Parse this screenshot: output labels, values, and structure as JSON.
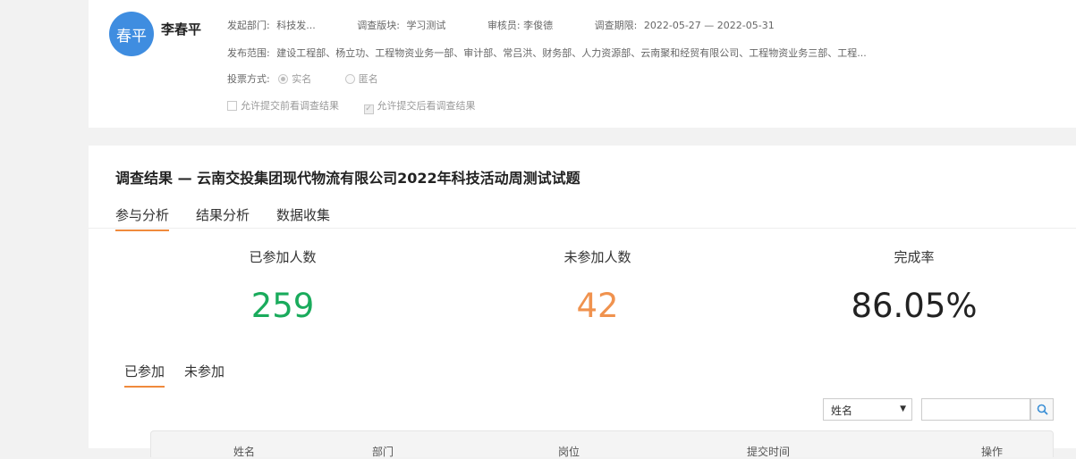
{
  "user": {
    "avatar_text": "春平",
    "name": "李春平"
  },
  "meta": {
    "dept_label": "发起部门:",
    "dept_value": "科技发...",
    "module_label": "调查版块:",
    "module_value": "学习测试",
    "reviewer_label": "审核员:",
    "reviewer_value": "李俊德",
    "period_label": "调查期限:",
    "period_value": "2022-05-27 — 2022-05-31",
    "scope_label": "发布范围:",
    "scope_value": "建设工程部、杨立功、工程物资业务一部、审计部、常吕洪、财务部、人力资源部、云南聚和经贸有限公司、工程物资业务三部、工程...",
    "vote_label": "投票方式:",
    "vote_options": [
      "实名",
      "匿名"
    ],
    "check_before": "允许提交前看调查结果",
    "check_after": "允许提交后看调查结果"
  },
  "page": {
    "title": "调查结果 — 云南交投集团现代物流有限公司2022年科技活动周测试试题",
    "tabs": [
      "参与分析",
      "结果分析",
      "数据收集"
    ]
  },
  "stats": {
    "joined_label": "已参加人数",
    "joined_value": "259",
    "not_joined_label": "未参加人数",
    "not_joined_value": "42",
    "rate_label": "完成率",
    "rate_value": "86.05%"
  },
  "subtabs": [
    "已参加",
    "未参加"
  ],
  "filter": {
    "selected": "姓名"
  },
  "table": {
    "headers": [
      "姓名",
      "部门",
      "岗位",
      "提交时间",
      "操作"
    ]
  },
  "colors": {
    "accent": "#f08a3c",
    "green": "#1aab5c",
    "orange": "#f0924e",
    "avatar": "#3f8de0"
  }
}
